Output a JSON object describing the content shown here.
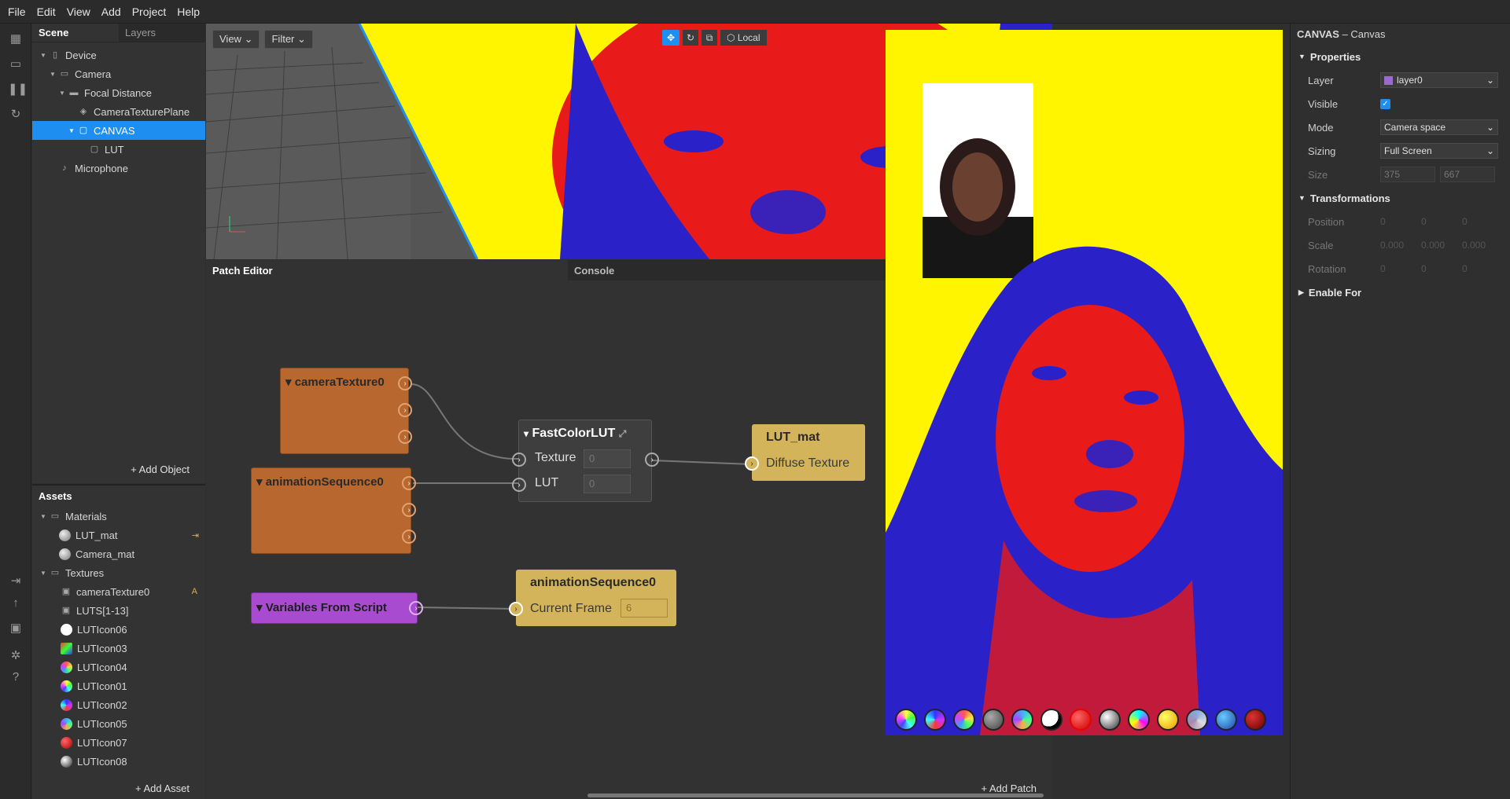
{
  "menu": {
    "file": "File",
    "edit": "Edit",
    "view": "View",
    "add": "Add",
    "project": "Project",
    "help": "Help"
  },
  "scene": {
    "tab_scene": "Scene",
    "tab_layers": "Layers",
    "items": [
      "Device",
      "Camera",
      "Focal Distance",
      "CameraTexturePlane",
      "CANVAS",
      "LUT",
      "Microphone"
    ],
    "add_object": "Add Object"
  },
  "assets": {
    "title": "Assets",
    "materials_folder": "Materials",
    "materials": [
      "LUT_mat",
      "Camera_mat"
    ],
    "textures_folder": "Textures",
    "textures": [
      "cameraTexture0",
      "LUTS[1-13]",
      "LUTIcon06",
      "LUTIcon03",
      "LUTIcon04",
      "LUTIcon01",
      "LUTIcon02",
      "LUTIcon05",
      "LUTIcon07",
      "LUTIcon08"
    ],
    "texture_badge": "A",
    "add_asset": "Add Asset"
  },
  "viewport": {
    "view_btn": "View",
    "filter_btn": "Filter",
    "local_btn": "Local"
  },
  "patch_editor": {
    "tab_patch": "Patch Editor",
    "tab_console": "Console",
    "add_patch": "Add Patch"
  },
  "nodes": {
    "camera_texture": "cameraTexture0",
    "animation_sequence": "animationSequence0",
    "variables": "Variables From Script",
    "fastcolorlut": "FastColorLUT",
    "texture_label": "Texture",
    "texture_value": "0",
    "lut_label": "LUT",
    "lut_value": "0",
    "lut_mat": "LUT_mat",
    "diffuse_texture": "Diffuse Texture",
    "anim_seq2": "animationSequence0",
    "current_frame": "Current Frame",
    "current_frame_value": "6"
  },
  "inspector": {
    "title_bold": "CANVAS",
    "title_rest": "– Canvas",
    "properties": "Properties",
    "layer_label": "Layer",
    "layer_value": "layer0",
    "visible_label": "Visible",
    "mode_label": "Mode",
    "mode_value": "Camera space",
    "sizing_label": "Sizing",
    "sizing_value": "Full Screen",
    "size_label": "Size",
    "size_w": "375",
    "size_h": "667",
    "transformations": "Transformations",
    "position_label": "Position",
    "scale_label": "Scale",
    "rotation_label": "Rotation",
    "pos_vals": [
      "0",
      "0",
      "0"
    ],
    "scale_vals": [
      "0.000",
      "0.000",
      "0.000"
    ],
    "rot_vals": [
      "0",
      "0",
      "0"
    ],
    "enable_for": "Enable For"
  },
  "colors": {
    "accent": "#1e8ff0",
    "orange_node": "#b8672e",
    "purple_node": "#a84bd0",
    "gold_node": "#d4b45a",
    "preview_yellow": "#fff500"
  }
}
